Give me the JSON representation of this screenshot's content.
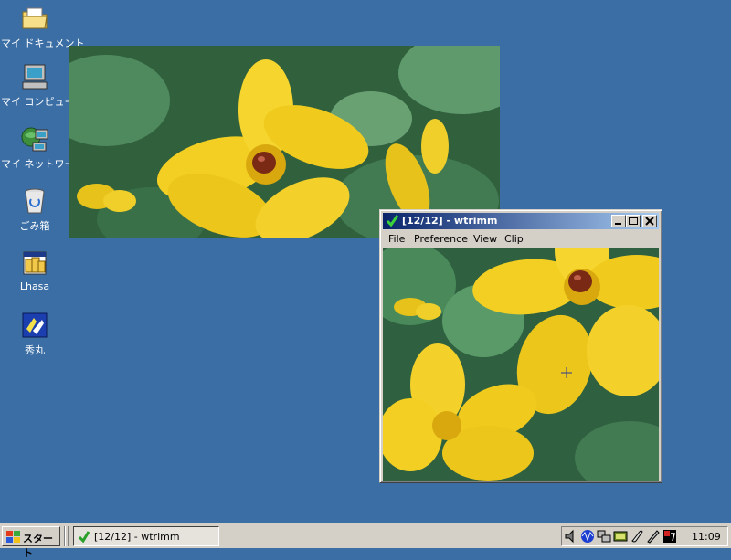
{
  "desktop": {
    "icons": [
      {
        "label": "マイ ドキュメント",
        "icon": "folder-documents-icon"
      },
      {
        "label": "マイ コンピュータ",
        "icon": "my-computer-icon"
      },
      {
        "label": "マイ ネットワーク",
        "icon": "network-places-icon"
      },
      {
        "label": "ごみ箱",
        "icon": "recycle-bin-icon"
      },
      {
        "label": "Lhasa",
        "icon": "lhasa-archiver-icon"
      },
      {
        "label": "秀丸",
        "icon": "hidemaru-editor-icon"
      }
    ],
    "background_color": "#3a6ea5"
  },
  "window": {
    "title": "[12/12] - wtrimm",
    "menu": [
      "File",
      "Preference",
      "View",
      "Clip"
    ],
    "controls": [
      "minimize",
      "maximize",
      "close"
    ]
  },
  "taskbar": {
    "start_label": "スタート",
    "tasks": [
      {
        "label": "[12/12] - wtrimm",
        "active": true
      }
    ],
    "tray_icons": [
      "volume-icon",
      "audio-wave-icon",
      "network-icon",
      "display-icon",
      "clip-icon",
      "pen-icon",
      "ime-icon"
    ],
    "clock": "11:09"
  }
}
